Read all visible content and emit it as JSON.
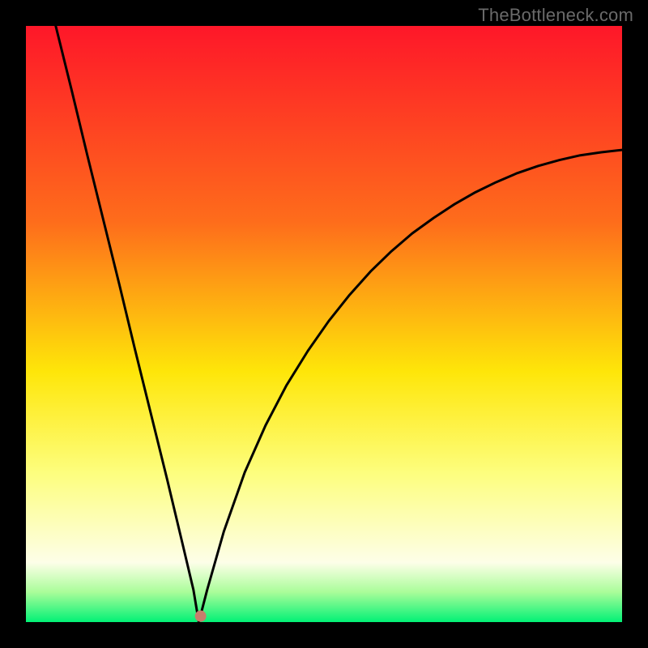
{
  "watermark": "TheBottleneck.com",
  "chart_data": {
    "type": "line",
    "title": "",
    "xlabel": "",
    "ylabel": "",
    "xlim": [
      0,
      100
    ],
    "ylim": [
      0,
      100
    ],
    "legend": false,
    "notes": "Bottleneck curve over red-yellow-green gradient background. Left branch descends steeply from top-left to the minimum point; right branch rises with decreasing slope toward the right edge. A small marker dot sits at the minimum.",
    "series": [
      {
        "name": "left-branch",
        "x": [
          5.0,
          7.7,
          10.3,
          13.0,
          15.7,
          18.3,
          21.0,
          23.7,
          26.3,
          28.1,
          29.0
        ],
        "y": [
          100.0,
          89.1,
          78.3,
          67.4,
          56.5,
          45.7,
          34.8,
          23.9,
          13.0,
          5.4,
          0.0
        ]
      },
      {
        "name": "right-branch",
        "x": [
          29.0,
          30.4,
          33.2,
          36.7,
          40.2,
          43.7,
          47.3,
          50.8,
          54.3,
          57.8,
          61.3,
          64.8,
          68.4,
          71.9,
          75.4,
          78.9,
          82.4,
          85.9,
          89.5,
          93.0,
          96.5,
          100.0
        ],
        "y": [
          0.0,
          5.4,
          15.2,
          25.1,
          33.0,
          39.7,
          45.5,
          50.5,
          54.9,
          58.8,
          62.2,
          65.2,
          67.8,
          70.1,
          72.1,
          73.8,
          75.3,
          76.5,
          77.5,
          78.3,
          78.8,
          79.2
        ]
      }
    ],
    "marker": {
      "x": 29.3,
      "y": 1.0,
      "color": "#c77d6c",
      "radius_px": 7
    }
  }
}
